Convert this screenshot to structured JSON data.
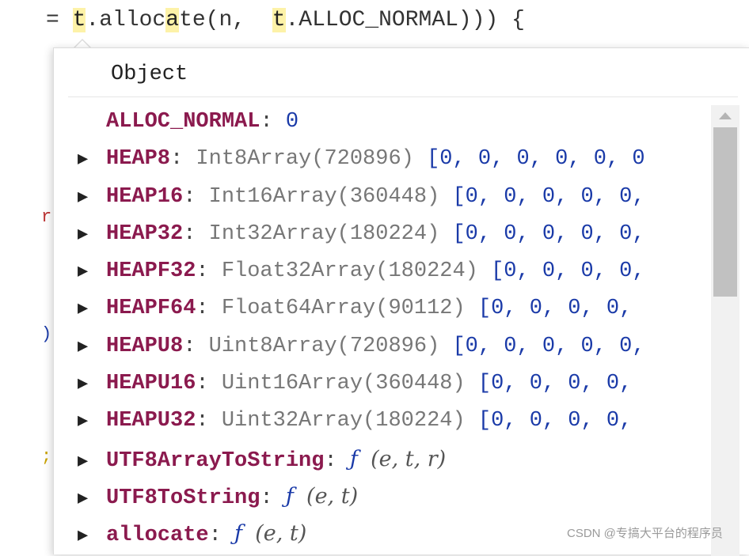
{
  "code": {
    "prefix": "= ",
    "t1": "t",
    "mid1": ".alloc",
    "a_hl": "a",
    "mid2": "te(n,  ",
    "t2": "t",
    "suffix": ".ALLOC_NORMAL))) {"
  },
  "popup": {
    "title": "Object",
    "rows": [
      {
        "key": "ALLOC_NORMAL",
        "value": "0",
        "expandable": false
      },
      {
        "key": "HEAP8",
        "type": "Int8Array(720896)",
        "preview": "[0,  0,  0,  0,  0,  0",
        "expandable": true
      },
      {
        "key": "HEAP16",
        "type": "Int16Array(360448)",
        "preview": "[0,  0,  0,  0,  0,",
        "expandable": true
      },
      {
        "key": "HEAP32",
        "type": "Int32Array(180224)",
        "preview": "[0,  0,  0,  0,  0,",
        "expandable": true
      },
      {
        "key": "HEAPF32",
        "type": "Float32Array(180224)",
        "preview": "[0,  0,  0,  0,",
        "expandable": true
      },
      {
        "key": "HEAPF64",
        "type": "Float64Array(90112)",
        "preview": "[0,  0,  0,  0,",
        "expandable": true
      },
      {
        "key": "HEAPU8",
        "type": "Uint8Array(720896)",
        "preview": "[0,  0,  0,  0,  0,",
        "expandable": true
      },
      {
        "key": "HEAPU16",
        "type": "Uint16Array(360448)",
        "preview": "[0,  0,  0,  0,",
        "expandable": true
      },
      {
        "key": "HEAPU32",
        "type": "Uint32Array(180224)",
        "preview": "[0,  0,  0,  0,",
        "expandable": true
      },
      {
        "key": "UTF8ArrayToString",
        "fn": "ƒ",
        "args": "(e, t, r)",
        "expandable": true
      },
      {
        "key": "UTF8ToString",
        "fn": "ƒ",
        "args": "(e, t)",
        "expandable": true
      },
      {
        "key": "allocate",
        "fn": "ƒ",
        "args": "(e, t)",
        "expandable": true
      }
    ]
  },
  "watermark": "CSDN @专搞大平台的程序员",
  "colors": {
    "key": "#8b1a4e",
    "number": "#1a3aa8",
    "highlight": "#fdf2a8"
  },
  "icons": {
    "expand": "triangle-right-icon",
    "scroll_up": "scroll-up-arrow-icon"
  }
}
